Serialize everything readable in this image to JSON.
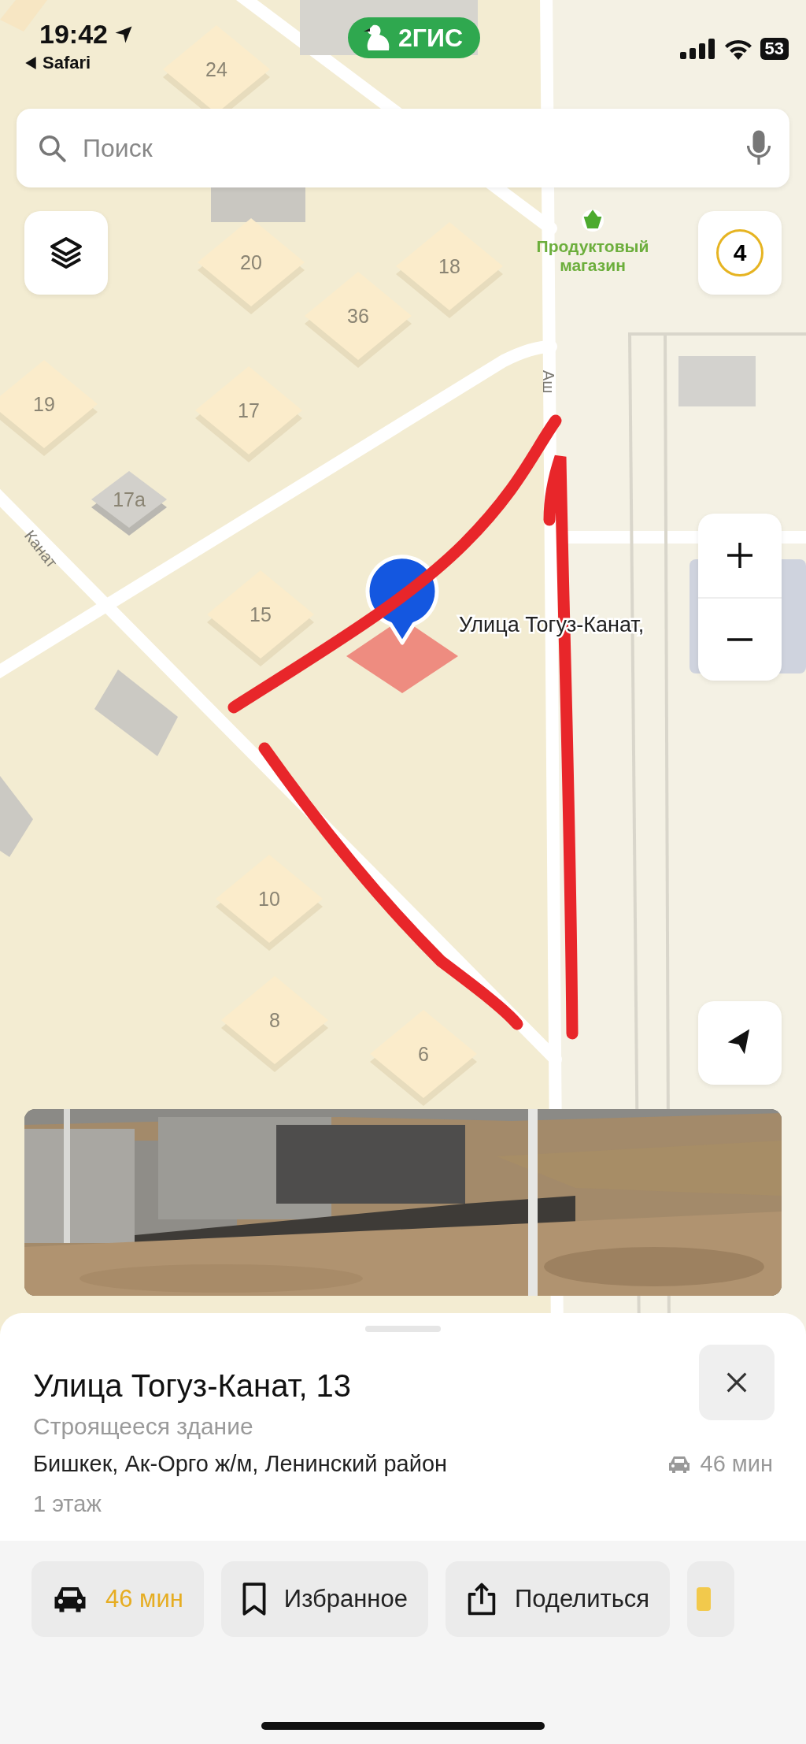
{
  "status_bar": {
    "time": "19:42",
    "back_label": "Safari",
    "battery": "53"
  },
  "app_badge": {
    "name": "2ГИС"
  },
  "search": {
    "placeholder": "Поиск"
  },
  "map": {
    "counter": "4",
    "poi": {
      "lines": [
        "Продуктовый",
        "магазин"
      ]
    },
    "houses": [
      {
        "number": "24"
      },
      {
        "number": "20"
      },
      {
        "number": "18"
      },
      {
        "number": "36"
      },
      {
        "number": "19"
      },
      {
        "number": "17"
      },
      {
        "number": "17а"
      },
      {
        "number": "15"
      },
      {
        "number": "10"
      },
      {
        "number": "8"
      },
      {
        "number": "6"
      }
    ],
    "streets": [
      "Аш",
      "Канат"
    ],
    "pin_label": "Улица Тогуз-Канат,"
  },
  "place": {
    "title": "Улица Тогуз-Канат, 13",
    "category": "Строящееся здание",
    "address": "Бишкек, Ак-Орго ж/м, Ленинский район",
    "drive_time": "46 мин",
    "floors": "1 этаж"
  },
  "actions": [
    {
      "kind": "route",
      "label": "46 мин"
    },
    {
      "kind": "bookmark",
      "label": "Избранное"
    },
    {
      "kind": "share",
      "label": "Поделиться"
    }
  ]
}
